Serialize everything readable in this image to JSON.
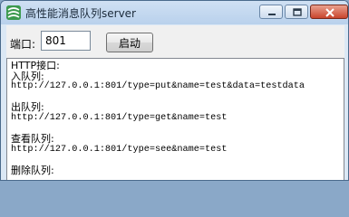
{
  "window": {
    "title": "高性能消息队列server",
    "icon": "app-icon",
    "colors": {
      "titlebar": "#c4d8ef",
      "close": "#c9452c"
    }
  },
  "form": {
    "port_label": "端口:",
    "port_value": "801",
    "start_button": "启动"
  },
  "output": {
    "lines": [
      "HTTP接口:",
      "入队列:",
      "http://127.0.0.1:801/type=put&name=test&data=testdata",
      "",
      "出队列:",
      "http://127.0.0.1:801/type=get&name=test",
      "",
      "查看队列:",
      "http://127.0.0.1:801/type=see&name=test",
      "",
      "删除队列:"
    ]
  }
}
